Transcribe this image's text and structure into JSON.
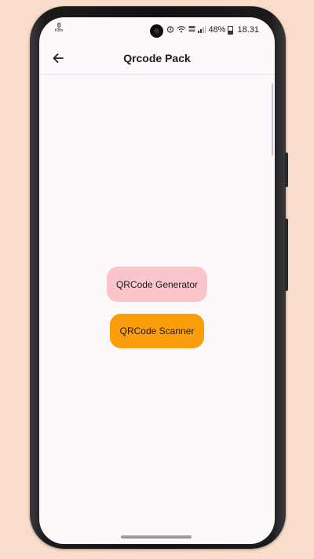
{
  "status_bar": {
    "network_speed_value": "0",
    "network_speed_unit": "KB/s",
    "battery_percent": "48%",
    "time": "18.31",
    "icons": [
      "alarm-icon",
      "wifi-icon",
      "volte-icon",
      "signal-icon",
      "battery-icon"
    ]
  },
  "app_bar": {
    "title": "Qrcode Pack",
    "back_icon": "arrow-left-icon"
  },
  "main": {
    "generator_button_label": "QRCode Generator",
    "scanner_button_label": "QRCode Scanner"
  },
  "colors": {
    "background": "#f9dcc9",
    "screen": "#fcf8fc",
    "generator_button": "#fbc5cb",
    "scanner_button": "#fb9e0b"
  }
}
